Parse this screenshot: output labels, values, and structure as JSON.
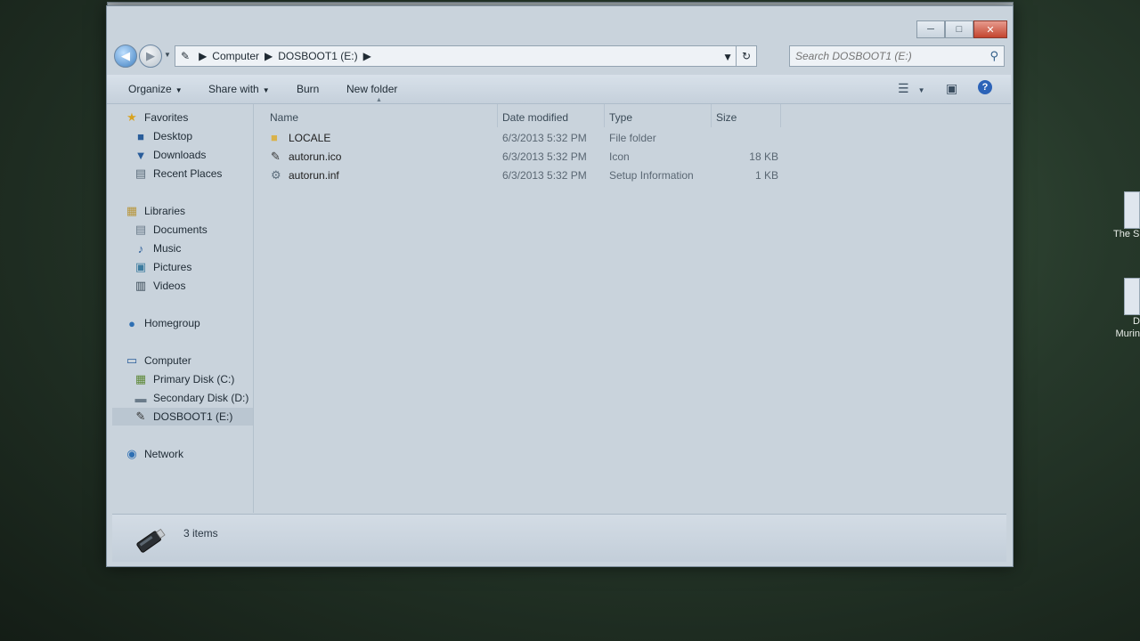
{
  "window": {
    "title": "DOSBOOT1 (E:)",
    "controls": {
      "minimize": "─",
      "maximize": "□",
      "close": "✕"
    }
  },
  "address": {
    "crumbs": [
      "Computer",
      "DOSBOOT1 (E:)"
    ],
    "search_placeholder": "Search DOSBOOT1 (E:)"
  },
  "toolbar": {
    "organize": "Organize",
    "share_with": "Share with",
    "burn": "Burn",
    "new_folder": "New folder"
  },
  "sidebar": {
    "favorites": {
      "header": "Favorites",
      "items": [
        "Desktop",
        "Downloads",
        "Recent Places"
      ]
    },
    "libraries": {
      "header": "Libraries",
      "items": [
        "Documents",
        "Music",
        "Pictures",
        "Videos"
      ]
    },
    "homegroup": "Homegroup",
    "computer": {
      "header": "Computer",
      "items": [
        "Primary Disk (C:)",
        "Secondary Disk (D:)",
        "DOSBOOT1 (E:)"
      ],
      "selected": "DOSBOOT1 (E:)"
    },
    "network": "Network"
  },
  "columns": {
    "name": "Name",
    "date": "Date modified",
    "type": "Type",
    "size": "Size"
  },
  "files": [
    {
      "name": "LOCALE",
      "date": "6/3/2013 5:32 PM",
      "type": "File folder",
      "size": "",
      "icon": "folder-icon"
    },
    {
      "name": "autorun.ico",
      "date": "6/3/2013 5:32 PM",
      "type": "Icon",
      "size": "18 KB",
      "icon": "usb-drive-icon"
    },
    {
      "name": "autorun.inf",
      "date": "6/3/2013 5:32 PM",
      "type": "Setup Information",
      "size": "1 KB",
      "icon": "setup-file-icon"
    }
  ],
  "details": {
    "item_count": "3 items"
  },
  "desktop": {
    "icons": [
      "The Si",
      "D\nMurin"
    ]
  }
}
